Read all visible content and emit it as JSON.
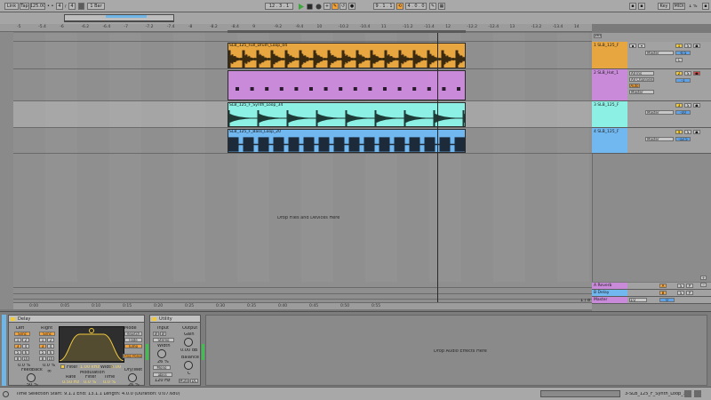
{
  "transport": {
    "link": "Link",
    "tap": "Tap",
    "tempo": "125.00",
    "sig_num": "4",
    "sig_den": "4",
    "metro": "1 Bar",
    "position": "12 . 3 . 1",
    "loop_start": "9 . 1 . 1",
    "loop_len": "4 . 0 . 0",
    "key": "Key",
    "midi": "MIDI",
    "cpu": "1 %"
  },
  "ruler_top": [
    "-5",
    "-5.4",
    "-6",
    "-6.2",
    "-6.4",
    "-7",
    "-7.2",
    "-7.4",
    "-8",
    "-8.2",
    "-8.4",
    "9",
    "-9.2",
    "-9.4",
    "10",
    "-10.2",
    "-10.4",
    "11",
    "-11.2",
    "-11.4",
    "12",
    "-12.2",
    "-12.4",
    "13",
    "-13.2",
    "-13.4",
    "14"
  ],
  "ruler_bottom": [
    "0:00",
    "0:05",
    "0:10",
    "0:15",
    "0:20",
    "0:25",
    "0:30",
    "0:35",
    "0:40",
    "0:45",
    "0:50",
    "0:55"
  ],
  "clips": [
    {
      "name": "SLB_125_Full_Drum_Loop_04",
      "color": "#e8a640"
    },
    {
      "name": "",
      "color": "#c98bd9"
    },
    {
      "name": "SLB_125_F_Synth_Loop_34",
      "color": "#8df0e4"
    },
    {
      "name": "SLB_125_F_Bass_Loop_20",
      "color": "#72b8f0"
    }
  ],
  "tracks": [
    {
      "name": "1 SLB_125_F",
      "color": "#e8a640",
      "route": "Master",
      "vol": "-0.5",
      "num": "1"
    },
    {
      "name": "2 SLB_Hat_1",
      "color": "#c98bd9",
      "route": "All Ins",
      "route2": "All Channels",
      "route3": "Master",
      "monitor": "Auto",
      "vol": "-1",
      "num": "2"
    },
    {
      "name": "3 SLB_125_F",
      "color": "#8df0e4",
      "route": "Master",
      "vol": "-10",
      "num": "3"
    },
    {
      "name": "4 SLB_125_F",
      "color": "#72b8f0",
      "route": "Master",
      "vol": "-12.5",
      "num": "4"
    }
  ],
  "returns": [
    {
      "name": "A Reverb",
      "color": "#c98bd9",
      "letter": "A"
    },
    {
      "name": "B Delay",
      "color": "#72b8f0",
      "letter": "B"
    },
    {
      "name": "Master",
      "color": "#c98bd9",
      "route": "1/2",
      "letter": "0"
    }
  ],
  "drop_text": "Drop Files and Devices Here",
  "drop_effects": "Drop Audio Effects Here",
  "delay": {
    "title": "Delay",
    "left": "Left",
    "right": "Right",
    "sync": "Sync",
    "mode": "Mode",
    "repitch": "Repitch",
    "fade": "Fade",
    "jump": "Jump",
    "ping_pong": "Ping Pong",
    "feedback": "Feedback",
    "feedback_val": "50 %",
    "filter": "Filter",
    "filter_val": "1.00 kHz",
    "width": "Width",
    "width_val": "8.00",
    "modulation": "Modulation",
    "rate": "Rate",
    "rate_val": "0.50 Hz",
    "filt": "Filter",
    "filt_val": "0.0 %",
    "time": "Time",
    "time_val": "0.0 %",
    "drywet": "Dry/Wet",
    "drywet_val": "26 %",
    "left_pct": "0.0 %",
    "right_pct": "0.0 %"
  },
  "utility": {
    "title": "Utility",
    "input": "Input",
    "output": "Output",
    "stereo": "Stereo",
    "width": "Width",
    "width_val": "26 %",
    "gain": "Gain",
    "gain_val": "0.00 dB",
    "mono": "Mono",
    "balance": "Balance",
    "balance_val": "C",
    "bass_mono": "Bass Mono",
    "bass_freq": "120 Hz",
    "mute": "Mute",
    "dc": "DC"
  },
  "status": {
    "left": "Time Selection   Start: 9.1.1   End: 13.1.1   Length: 4.0.0   (Duration: 0:07.680)",
    "right": "3-SLB_125_F_Synth_Loop_34"
  },
  "page_ratio": "1 / 8"
}
